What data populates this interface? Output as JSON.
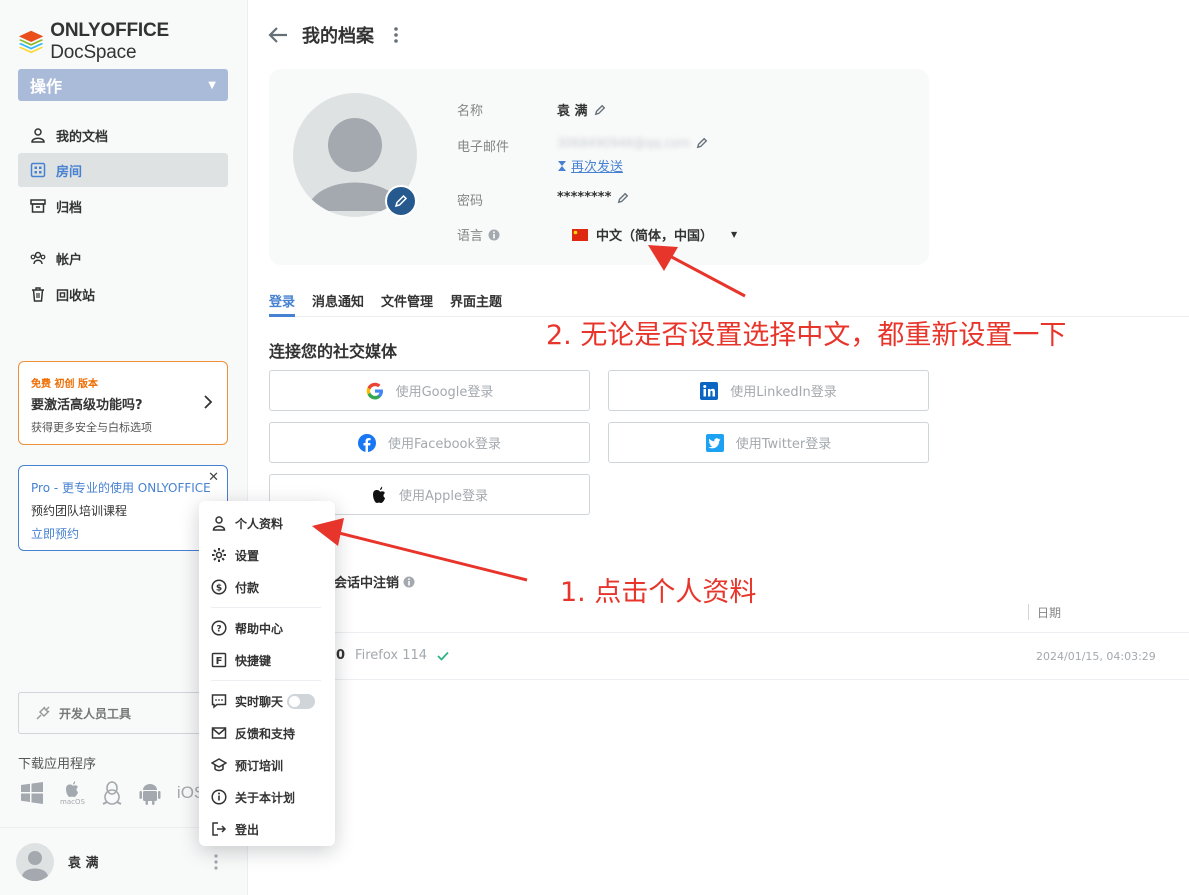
{
  "brand": {
    "name_bold": "ONLYOFFICE",
    "name_light": "DocSpace"
  },
  "sidebar": {
    "action_label": "操作",
    "items": [
      {
        "label": "我的文档",
        "icon": "user-icon"
      },
      {
        "label": "房间",
        "icon": "rooms-icon",
        "active": true
      },
      {
        "label": "归档",
        "icon": "archive-icon"
      },
      {
        "label": "帐户",
        "icon": "accounts-icon"
      },
      {
        "label": "回收站",
        "icon": "trash-icon"
      }
    ],
    "promo_free": {
      "tag": "免费 初创 版本",
      "title": "要激活高级功能吗?",
      "desc": "获得更多安全与白标选项"
    },
    "promo_pro": {
      "title": "Pro - 更专业的使用 ONLYOFFICE",
      "desc": "预约团队培训课程",
      "link": "立即预约"
    },
    "dev_tools": "开发人员工具",
    "download_label": "下载应用程序",
    "download_apps": [
      "windows-icon",
      "macos-icon",
      "linux-icon",
      "android-icon",
      "ios-icon"
    ],
    "download_macos_caption": "macOS",
    "download_ios_caption": "iOS",
    "user_name": "袁 满"
  },
  "header": {
    "title": "我的档案"
  },
  "profile": {
    "labels": {
      "name": "名称",
      "email": "电子邮件",
      "password": "密码",
      "language": "语言"
    },
    "name": "袁 满",
    "email": "3068490946@qq.com",
    "resend": "再次发送",
    "password": "********",
    "language": "中文（简体，中国）"
  },
  "tabs": [
    "登录",
    "消息通知",
    "文件管理",
    "界面主题"
  ],
  "social": {
    "title": "连接您的社交媒体",
    "buttons": [
      {
        "label": "使用Google登录",
        "icon": "google-icon"
      },
      {
        "label": "使用LinkedIn登录",
        "icon": "linkedin-icon"
      },
      {
        "label": "使用Facebook登录",
        "icon": "facebook-icon"
      },
      {
        "label": "使用Twitter登录",
        "icon": "twitter-icon"
      },
      {
        "label": "使用Apple登录",
        "icon": "apple-icon"
      }
    ]
  },
  "sessions": {
    "title": "会话中注销",
    "date_header": "日期",
    "row": {
      "os": "0",
      "browser": "Firefox 114",
      "date": "2024/01/15, 04:03:29"
    }
  },
  "menu": {
    "items": [
      {
        "label": "个人资料",
        "icon": "profile-icon"
      },
      {
        "label": "设置",
        "icon": "gear-icon"
      },
      {
        "label": "付款",
        "icon": "payment-icon"
      },
      {
        "label": "帮助中心",
        "icon": "help-icon"
      },
      {
        "label": "快捷键",
        "icon": "hotkeys-icon"
      },
      {
        "label": "实时聊天",
        "icon": "chat-icon"
      },
      {
        "label": "反馈和支持",
        "icon": "mail-icon"
      },
      {
        "label": "预订培训",
        "icon": "training-icon"
      },
      {
        "label": "关于本计划",
        "icon": "info-icon"
      },
      {
        "label": "登出",
        "icon": "logout-icon"
      }
    ]
  },
  "annotations": {
    "step1": "1. 点击个人资料",
    "step2": "2. 无论是否设置选择中文，都重新设置一下"
  },
  "colors": {
    "accent": "#4781d1",
    "annotation": "#e8352b",
    "promo": "#ef8f38"
  }
}
